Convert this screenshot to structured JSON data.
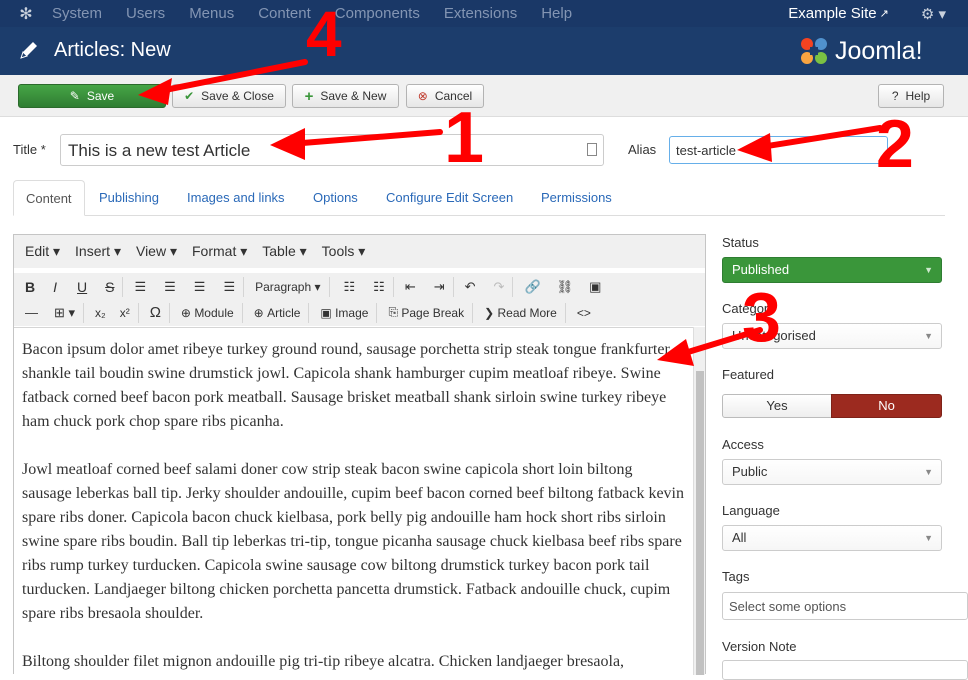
{
  "topbar": {
    "menu": [
      "System",
      "Users",
      "Menus",
      "Content",
      "Components",
      "Extensions",
      "Help"
    ],
    "site_link": "Example Site"
  },
  "header": {
    "title": "Articles: New",
    "brand": "Joomla!"
  },
  "toolbar": {
    "save": "Save",
    "save_close": "Save & Close",
    "save_new": "Save & New",
    "cancel": "Cancel",
    "help": "Help"
  },
  "form": {
    "title_label": "Title *",
    "title_value": "This is a new test Article",
    "alias_label": "Alias",
    "alias_value": "test-article"
  },
  "tabs": [
    "Content",
    "Publishing",
    "Images and links",
    "Options",
    "Configure Edit Screen",
    "Permissions"
  ],
  "editor": {
    "menus": [
      "Edit",
      "Insert",
      "View",
      "Format",
      "Table",
      "Tools"
    ],
    "format_select": "Paragraph",
    "buttons": {
      "module": "Module",
      "article": "Article",
      "image": "Image",
      "page_break": "Page Break",
      "read_more": "Read More"
    },
    "paragraphs": [
      "Bacon ipsum dolor amet ribeye turkey ground round, sausage porchetta strip steak tongue frankfurter shankle tail boudin swine drumstick jowl. Capicola shank hamburger cupim meatloaf ribeye. Swine fatback corned beef bacon pork meatball. Sausage brisket meatball shank sirloin swine turkey ribeye ham chuck pork chop spare ribs picanha.",
      "Jowl meatloaf corned beef salami doner cow strip steak bacon swine capicola short loin biltong sausage leberkas ball tip. Jerky shoulder andouille, cupim beef bacon corned beef biltong fatback kevin spare ribs doner. Capicola bacon chuck kielbasa, pork belly pig andouille ham hock short ribs sirloin swine spare ribs boudin. Ball tip leberkas tri-tip, tongue picanha sausage chuck kielbasa beef ribs spare ribs rump turkey turducken. Capicola swine sausage cow biltong drumstick turkey bacon pork tail turducken. Landjaeger biltong chicken porchetta pancetta drumstick. Fatback andouille chuck, cupim spare ribs bresaola shoulder.",
      "Biltong shoulder filet mignon andouille pig tri-tip ribeye alcatra. Chicken landjaeger bresaola,"
    ]
  },
  "sidebar": {
    "status_label": "Status",
    "status_value": "Published",
    "category_label": "Category",
    "category_value": "Uncategorised",
    "featured_label": "Featured",
    "featured_yes": "Yes",
    "featured_no": "No",
    "access_label": "Access",
    "access_value": "Public",
    "language_label": "Language",
    "language_value": "All",
    "tags_label": "Tags",
    "tags_placeholder": "Select some options",
    "version_label": "Version Note"
  },
  "annotations": [
    "1",
    "2",
    "3",
    "4"
  ],
  "colors": {
    "annotation": "#ff0000",
    "header": "#1c3d6c",
    "save": "#3a963a",
    "published": "#3a963a",
    "featured_no": "#9c2a1f"
  }
}
